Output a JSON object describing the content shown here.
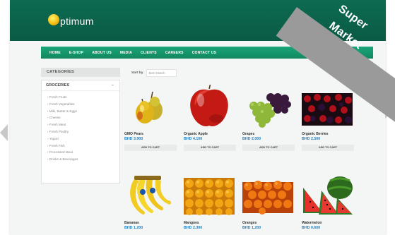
{
  "brand": {
    "logo_text": "ptimum"
  },
  "nav": [
    "HOME",
    "E-SHOP",
    "ABOUT US",
    "MEDIA",
    "CLIENTS",
    "CAREERS",
    "CONTACT US"
  ],
  "sidebar": {
    "header": "CATEGORIES",
    "group": "GROCERIES",
    "collapse_symbol": "–",
    "items": [
      "› Fresh Fruits",
      "› Fresh Vegetables",
      "› Milk, Butter & Eggs",
      "› Cheese",
      "› Fresh Meat",
      "› Fresh Poultry",
      "› Yogurt",
      "› Fresh Fish",
      "› Processed Meat",
      "› Drinks & Beverages"
    ]
  },
  "sort": {
    "label": "Sort by",
    "value": "Best Match"
  },
  "products": [
    {
      "name": "GMO Pears",
      "price": "BHD 3.900",
      "button": "ADD TO CART"
    },
    {
      "name": "Organic Apple",
      "price": "BHD 4.100",
      "button": "ADD TO CART"
    },
    {
      "name": "Grapes",
      "price": "BHD 2.000",
      "button": "ADD TO CART"
    },
    {
      "name": "Organic Berries",
      "price": "BHD 2.500",
      "button": "ADD TO CART"
    },
    {
      "name": "Bananas",
      "price": "BHD 1.200"
    },
    {
      "name": "Mangoes",
      "price": "BHD 2.300"
    },
    {
      "name": "Oranges",
      "price": "BHD 1.200"
    },
    {
      "name": "Watermelon",
      "price": "BHD 0.600"
    }
  ],
  "ribbon": {
    "line1": "Super",
    "line2": "Market"
  },
  "colors": {
    "header": "#0d6b52",
    "nav": "#1aa57a",
    "price": "#1f7fbf",
    "ribbon": "#9a9a9a"
  }
}
